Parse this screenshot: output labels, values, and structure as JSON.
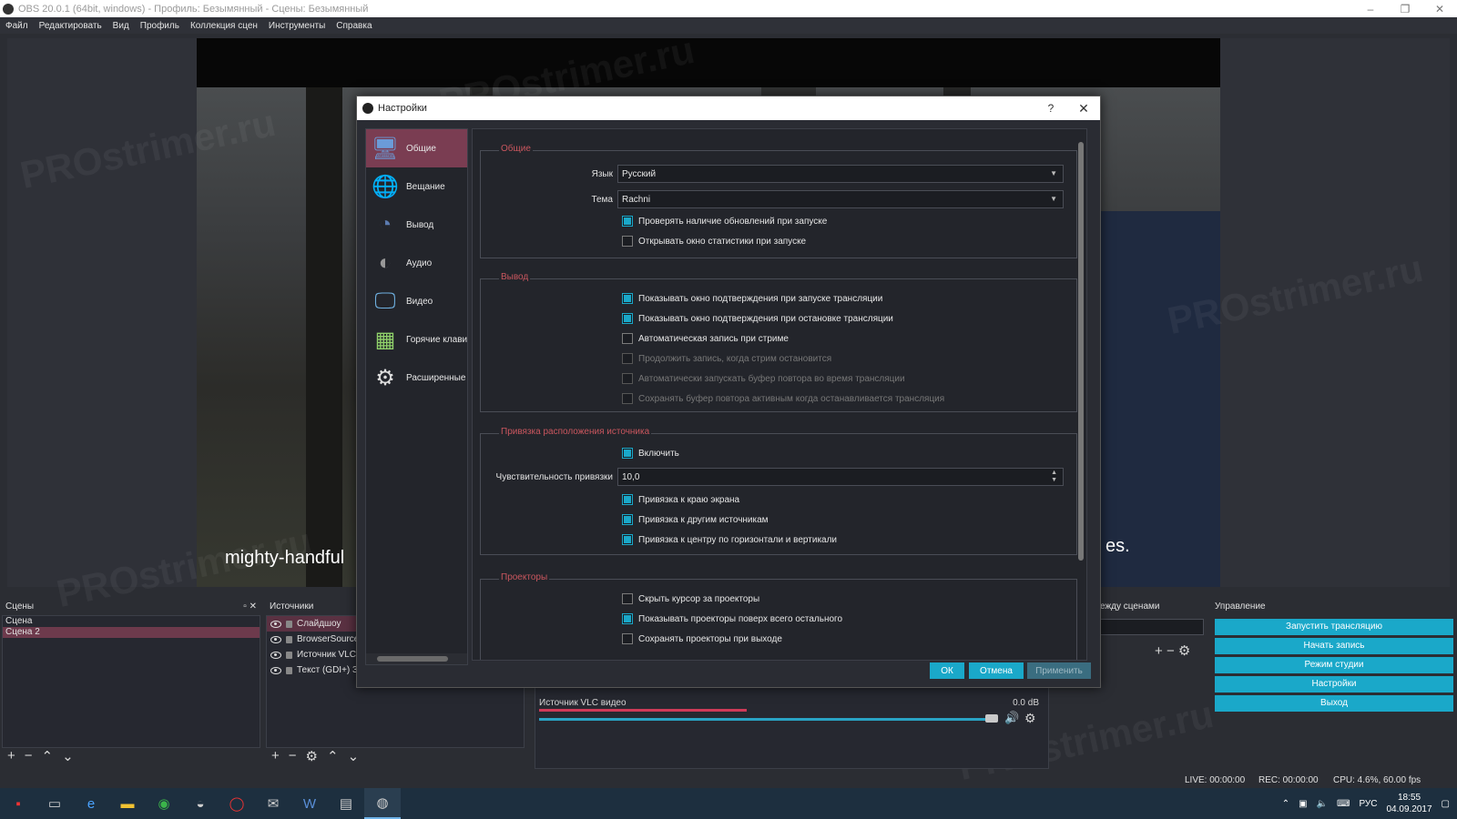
{
  "window": {
    "title": "OBS 20.0.1 (64bit, windows) - Профиль: Безымянный - Сцены: Безымянный"
  },
  "menu": [
    "Файл",
    "Редактировать",
    "Вид",
    "Профиль",
    "Коллекция сцен",
    "Инструменты",
    "Справка"
  ],
  "preview": {
    "caption_left": "mighty-handful",
    "caption_right": "es."
  },
  "watermark": "PROstrimer.ru",
  "docks": {
    "scenes": {
      "title": "Сцены",
      "items": [
        "Сцена",
        "Сцена 2"
      ],
      "selected_index": 1
    },
    "sources": {
      "title": "Источники",
      "items": [
        "Слайдшоу",
        "BrowserSource",
        "Источник VLC в",
        "Текст (GDI+) 3"
      ]
    },
    "mixer": {
      "source_name": "Источник VLC видео",
      "level": "0.0 dB"
    },
    "transitions": {
      "title": "ежду сценами"
    },
    "controls": {
      "title": "Управление",
      "buttons": [
        "Запустить трансляцию",
        "Начать запись",
        "Режим студии",
        "Настройки",
        "Выход"
      ]
    }
  },
  "status": {
    "live": "LIVE: 00:00:00",
    "rec": "REC: 00:00:00",
    "cpu": "CPU: 4.6%, 60.00 fps"
  },
  "taskbar": {
    "lang": "РУС",
    "time": "18:55",
    "date": "04.09.2017"
  },
  "settings": {
    "title": "Настройки",
    "help": "?",
    "categories": [
      {
        "label": "Общие",
        "icon": "general-icon"
      },
      {
        "label": "Вещание",
        "icon": "stream-icon"
      },
      {
        "label": "Вывод",
        "icon": "output-icon"
      },
      {
        "label": "Аудио",
        "icon": "audio-icon"
      },
      {
        "label": "Видео",
        "icon": "video-icon"
      },
      {
        "label": "Горячие клавиши",
        "icon": "hotkeys-icon"
      },
      {
        "label": "Расширенные",
        "icon": "advanced-icon"
      }
    ],
    "general": {
      "title": "Общие",
      "language_label": "Язык",
      "language_value": "Русский",
      "theme_label": "Тема",
      "theme_value": "Rachni",
      "check_updates": "Проверять наличие обновлений при запуске",
      "open_stats": "Открывать окно статистики при запуске"
    },
    "output": {
      "title": "Вывод",
      "confirm_start": "Показывать окно подтверждения при запуске трансляции",
      "confirm_stop": "Показывать окно подтверждения при остановке трансляции",
      "auto_record": "Автоматическая запись при стриме",
      "keep_recording": "Продолжить запись, когда стрим остановится",
      "auto_replay": "Автоматически запускать буфер повтора во время трансляции",
      "keep_replay": "Сохранять буфер повтора активным когда останавливается трансляция"
    },
    "snapping": {
      "title": "Привязка расположения источника",
      "enable": "Включить",
      "sensitivity_label": "Чувствительность привязки",
      "sensitivity_value": "10,0",
      "screen_edge": "Привязка к краю экрана",
      "other_sources": "Привязка к другим источникам",
      "center": "Привязка к центру по горизонтали и вертикали"
    },
    "projectors": {
      "title": "Проекторы",
      "hide_cursor": "Скрыть курсор за проекторы",
      "always_on_top": "Показывать проекторы поверх всего остального",
      "save_on_exit": "Сохранять проекторы при выходе"
    },
    "buttons": {
      "ok": "ОК",
      "cancel": "Отмена",
      "apply": "Применить"
    }
  },
  "colors": {
    "accent": "#1aa8c9",
    "selection": "#7a3d52",
    "group_title": "#c9565e"
  }
}
